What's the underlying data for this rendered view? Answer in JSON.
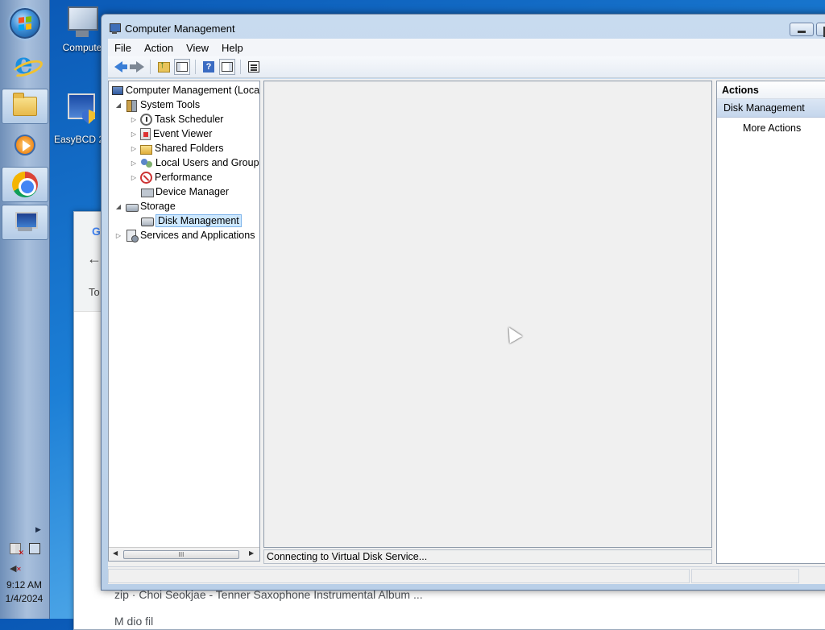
{
  "taskbar": {
    "clock_time": "9:12 AM",
    "clock_date": "1/4/2024"
  },
  "desktop": {
    "icons": [
      {
        "label": "Compute"
      },
      {
        "label": "EasyBCD 2"
      }
    ]
  },
  "browser": {
    "text_partial": "To",
    "result_line": "zip · Choi Seokjae - Tenner Saxophone Instrumental Album ...",
    "result_line2": "M                dio         fil"
  },
  "window": {
    "title": "Computer Management",
    "menu": [
      "File",
      "Action",
      "View",
      "Help"
    ]
  },
  "tree": {
    "root": "Computer Management (Local",
    "system_tools": "System Tools",
    "task_scheduler": "Task Scheduler",
    "event_viewer": "Event Viewer",
    "shared_folders": "Shared Folders",
    "local_users": "Local Users and Groups",
    "performance": "Performance",
    "device_manager": "Device Manager",
    "storage": "Storage",
    "disk_management": "Disk Management",
    "services": "Services and Applications"
  },
  "center": {
    "status_text": "Connecting to Virtual Disk Service..."
  },
  "actions": {
    "header": "Actions",
    "section": "Disk Management",
    "more": "More Actions"
  },
  "icons": {
    "scroll_thumb_grip": "III"
  }
}
